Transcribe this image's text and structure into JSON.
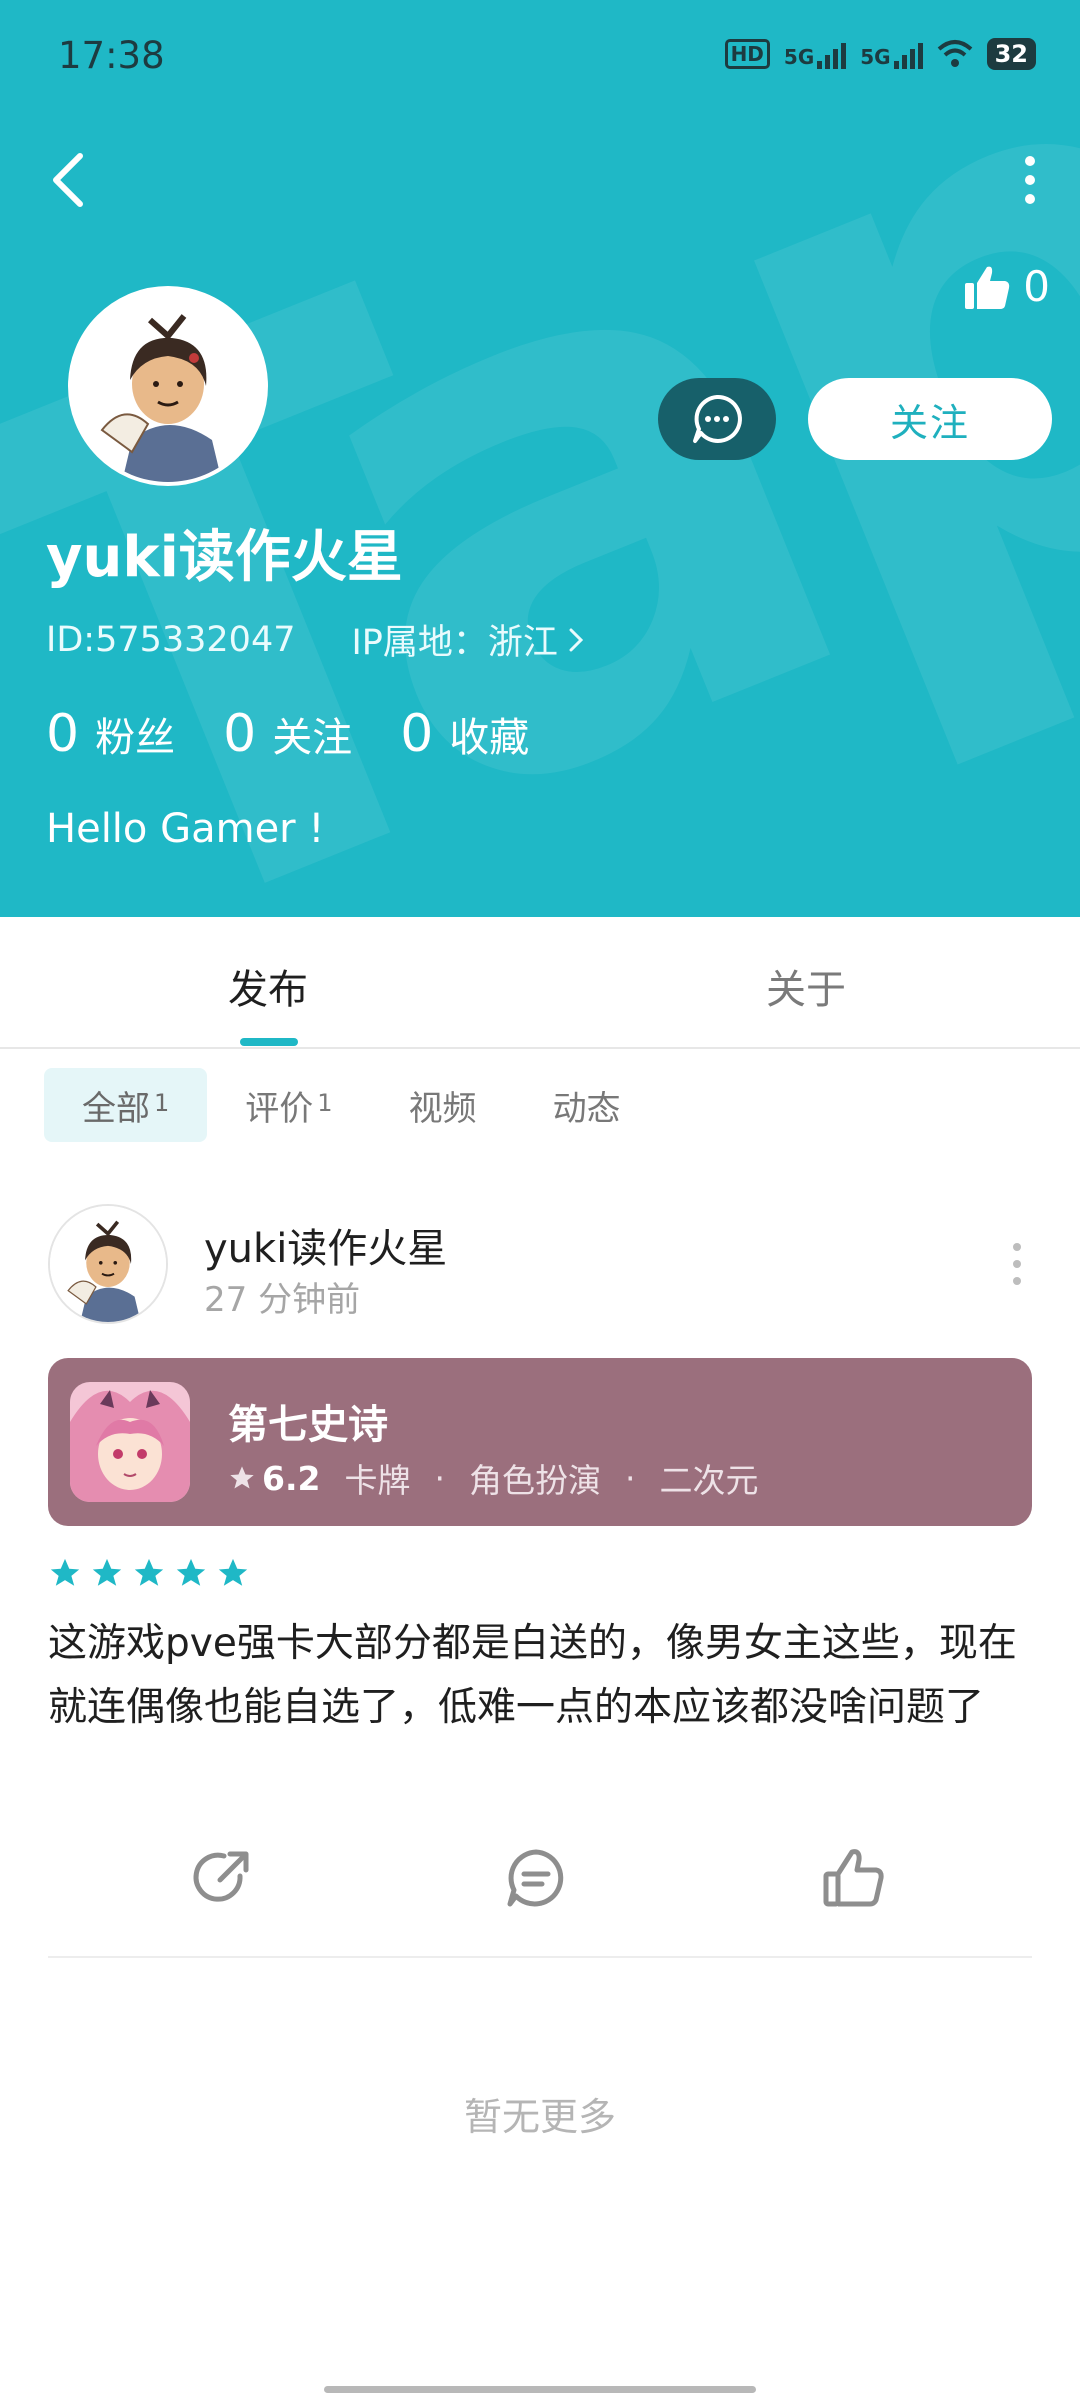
{
  "status_bar": {
    "time": "17:38",
    "hd_label": "HD",
    "net1": "5G",
    "net2": "5G",
    "battery": "32"
  },
  "profile": {
    "name": "yuki读作火星",
    "id": "ID:575332047",
    "ip_location": "IP属地：浙江",
    "likes": "0",
    "follow_label": "关注",
    "stats": [
      {
        "value": "0",
        "label": "粉丝"
      },
      {
        "value": "0",
        "label": "关注"
      },
      {
        "value": "0",
        "label": "收藏"
      }
    ],
    "bio": "Hello Gamer !"
  },
  "tabs": [
    {
      "label": "发布",
      "active": true
    },
    {
      "label": "关于",
      "active": false
    }
  ],
  "filters": [
    {
      "label": "全部",
      "count": "1",
      "active": true
    },
    {
      "label": "评价",
      "count": "1",
      "active": false
    },
    {
      "label": "视频",
      "count": "",
      "active": false
    },
    {
      "label": "动态",
      "count": "",
      "active": false
    }
  ],
  "post": {
    "author": "yuki读作火星",
    "time": "27 分钟前",
    "game": {
      "title": "第七史诗",
      "score": "6.2",
      "tags": [
        "卡牌",
        "角色扮演",
        "二次元"
      ]
    },
    "rating": 5,
    "text": "这游戏pve强卡大部分都是白送的，像男女主这些，现在就连偶像也能自选了，低难一点的本应该都没啥问题了"
  },
  "footer": {
    "no_more": "暂无更多"
  },
  "colors": {
    "header_bg": "#1fb8c6",
    "accent": "#1fb8c6",
    "game_card_bg": "#9b6f7d"
  }
}
